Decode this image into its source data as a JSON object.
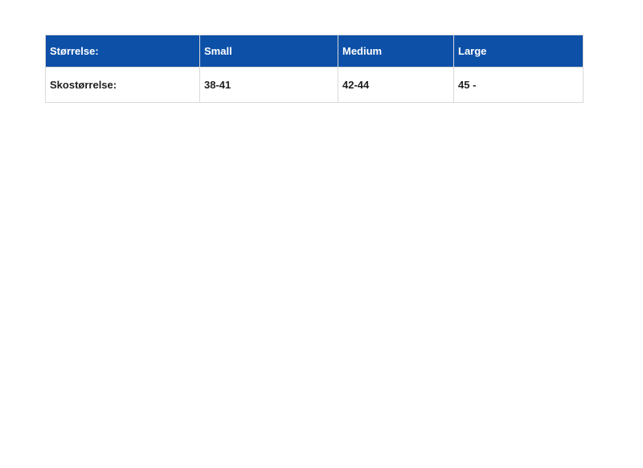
{
  "colors": {
    "header_bg": "#0c50a8",
    "header_text": "#ffffff",
    "body_text": "#1f1f1f",
    "border": "#d9d9d9",
    "page_bg": "#ffffff"
  },
  "size_chart": {
    "columns": [
      {
        "label": "Størrelse:"
      },
      {
        "label": "Small"
      },
      {
        "label": "Medium"
      },
      {
        "label": "Large"
      }
    ],
    "rows": [
      {
        "cells": [
          "Skostørrelse:",
          "38-41",
          "42-44",
          "45 -"
        ]
      }
    ]
  }
}
